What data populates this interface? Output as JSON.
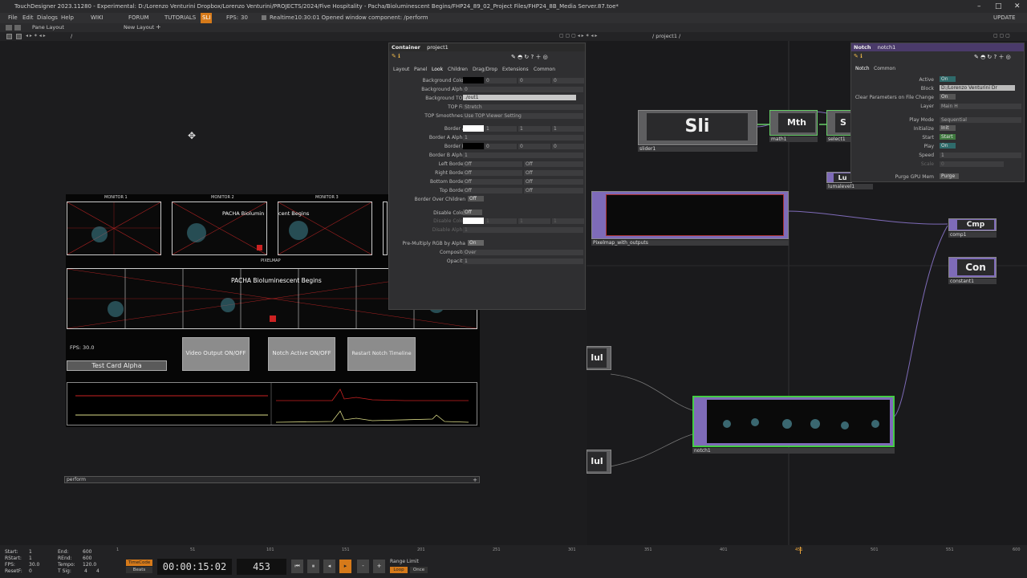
{
  "window": {
    "title": "TouchDesigner 2023.11280 - Experimental: D:/Lorenzo Venturini Dropbox/Lorenzo Venturini/PROJECTS/2024/Five Hospitality - Pacha/Bioluminescent Begins/FHP24_89_02_Project Files/FHP24_8B_Media Server.87.toe*"
  },
  "menubar": {
    "file": "File",
    "edit": "Edit",
    "dialogs": "Dialogs",
    "help": "Help",
    "wiki": "WIKI",
    "forum": "FORUM",
    "tutorials": "TUTORIALS",
    "sli": "SLI",
    "fps_label": "FPS:",
    "fps_value": "30",
    "realtime": "Realtime",
    "status": "10:30:01 Opened window component: /perform",
    "update": "UPDATE"
  },
  "panes": {
    "pane_layout": "Pane Layout",
    "new_layout": "New Layout",
    "left_path": "/",
    "right_path": "/ project1 /"
  },
  "perform": {
    "monitors": [
      "MONITOR 1",
      "MONITOR 2",
      "MONITOR 3"
    ],
    "pacha_small": "PACHA Biolumin",
    "begins_small": "cent Begins",
    "pixelmap_label": "PIXELMAP",
    "pacha_big": "PACHA Bioluminescent Begins",
    "fps": "FPS: 30.0",
    "test_card": "Test Card Alpha",
    "video_output": "Video Output ON/OFF",
    "notch_active": "Notch Active ON/OFF",
    "restart_notch": "Restart Notch Timeline",
    "window_name": "perform"
  },
  "container_panel": {
    "type": "Container",
    "name": "project1",
    "tabs": [
      "Layout",
      "Panel",
      "Look",
      "Children",
      "Drag/Drop",
      "Extensions",
      "Common"
    ],
    "params": [
      {
        "label": "Background Color",
        "values": [
          "0",
          "0",
          "0"
        ]
      },
      {
        "label": "Background Alpha",
        "values": [
          "0"
        ]
      },
      {
        "label": "Background TOP",
        "values": [
          "./out1"
        ]
      },
      {
        "label": "TOP Fill",
        "values": [
          "Stretch"
        ]
      },
      {
        "label": "TOP Smoothness",
        "values": [
          "Use TOP Viewer Setting"
        ]
      },
      {
        "label": "Border A",
        "values": [
          "1",
          "1",
          "1"
        ]
      },
      {
        "label": "Border A Alpha",
        "values": [
          "1"
        ]
      },
      {
        "label": "Border B",
        "values": [
          "0",
          "0",
          "0"
        ]
      },
      {
        "label": "Border B Alpha",
        "values": [
          "1"
        ]
      },
      {
        "label": "Left Border",
        "values": [
          "Off",
          "Off"
        ]
      },
      {
        "label": "Right Border",
        "values": [
          "Off",
          "Off"
        ]
      },
      {
        "label": "Bottom Border",
        "values": [
          "Off",
          "Off"
        ]
      },
      {
        "label": "Top Border",
        "values": [
          "Off",
          "Off"
        ]
      },
      {
        "label": "Border Over Children",
        "values": [
          "Off"
        ]
      },
      {
        "label": "Disable Color",
        "values": [
          "Off"
        ]
      },
      {
        "label": "Disable Color",
        "values": [
          "1",
          "1",
          "1"
        ]
      },
      {
        "label": "Disable Alpha",
        "values": [
          "1"
        ]
      },
      {
        "label": "Pre-Multiply RGB by Alpha",
        "values": [
          "On"
        ]
      },
      {
        "label": "Composite",
        "values": [
          "Over"
        ]
      },
      {
        "label": "Opacity",
        "values": [
          "1"
        ]
      }
    ]
  },
  "notch_panel": {
    "type": "Notch",
    "name": "notch1",
    "tabs": [
      "Notch",
      "Common"
    ],
    "params": [
      {
        "label": "Active",
        "value": "On"
      },
      {
        "label": "Block",
        "value": "D:/Lorenzo Venturini Dr"
      },
      {
        "label": "Clear Parameters on File Change",
        "value": "On"
      },
      {
        "label": "Layer",
        "value": "Main H"
      },
      {
        "label": "Play Mode",
        "value": "Sequential"
      },
      {
        "label": "Initialize",
        "value": "Init"
      },
      {
        "label": "Start",
        "value": "Start"
      },
      {
        "label": "Play",
        "value": "On"
      },
      {
        "label": "Speed",
        "value": "1"
      },
      {
        "label": "Scale",
        "value": "0"
      },
      {
        "label": "Purge GPU Mem",
        "value": "Purge"
      }
    ]
  },
  "nodes": {
    "slider": {
      "title": "Sli",
      "label": "slider1"
    },
    "math": {
      "title": "Mth",
      "label": "math1"
    },
    "select": {
      "title": "S",
      "label": "select1"
    },
    "lumalevel": {
      "title": "Lu",
      "label": "lumalevel1"
    },
    "pixelmap": {
      "label": "Pixelmap_with_outputs"
    },
    "comp": {
      "title": "Cmp",
      "label": "comp1"
    },
    "constant": {
      "title": "Con",
      "label": "constant1"
    },
    "mul1": {
      "title": "lul"
    },
    "mul2": {
      "title": "lul"
    },
    "notch": {
      "label": "notch1"
    }
  },
  "timeline": {
    "start_label": "Start:",
    "start": "1",
    "end_label": "End:",
    "end": "600",
    "rstart_label": "RStart:",
    "rstart": "1",
    "rend_label": "REnd:",
    "rend": "600",
    "fps_label": "FPS:",
    "fps": "30.0",
    "tempo_label": "Tempo:",
    "tempo": "120.0",
    "resetf_label": "ResetF:",
    "resetf": "0",
    "tsig_label": "T Sig:",
    "tsig_a": "4",
    "tsig_b": "4",
    "timecode_btn": "TimeCode",
    "beats_btn": "Beats",
    "timecode": "00:00:15:02",
    "frame": "453",
    "range_limit": "Range Limit",
    "loop": "Loop",
    "once": "Once",
    "ruler": [
      "1",
      "51",
      "101",
      "151",
      "201",
      "251",
      "301",
      "351",
      "401",
      "451",
      "501",
      "551",
      "600"
    ]
  }
}
